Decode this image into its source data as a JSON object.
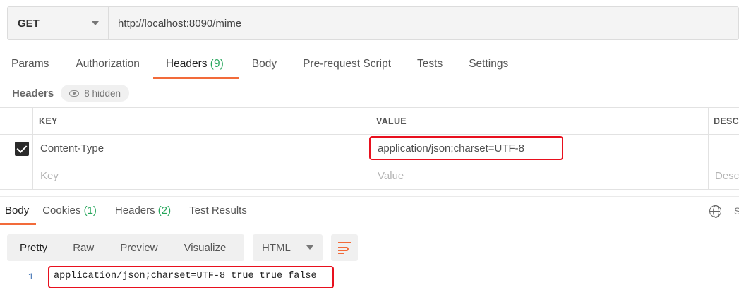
{
  "request": {
    "method": "GET",
    "url": "http://localhost:8090/mime"
  },
  "request_tabs": {
    "params": "Params",
    "authorization": "Authorization",
    "headers": "Headers",
    "headers_count": "(9)",
    "body": "Body",
    "pre_request": "Pre-request Script",
    "tests": "Tests",
    "settings": "Settings"
  },
  "headers_section": {
    "title": "Headers",
    "hidden_label": "8 hidden"
  },
  "headers_table": {
    "columns": [
      "KEY",
      "VALUE",
      "DESCR"
    ],
    "rows": [
      {
        "checked": true,
        "key": "Content-Type",
        "value": "application/json;charset=UTF-8"
      }
    ],
    "placeholders": {
      "key": "Key",
      "value": "Value",
      "description": "Desc"
    }
  },
  "response_tabs": {
    "body": "Body",
    "cookies": "Cookies",
    "cookies_count": "(1)",
    "headers": "Headers",
    "headers_count": "(2)",
    "test_results": "Test Results",
    "cut_label": "S"
  },
  "response_toolbar": {
    "views": [
      "Pretty",
      "Raw",
      "Preview",
      "Visualize"
    ],
    "active_view": "Pretty",
    "format": "HTML"
  },
  "response_body": {
    "line_number": "1",
    "text": "application/json;charset=UTF-8 true true false"
  },
  "colors": {
    "accent": "#f26b3a",
    "count_green": "#26a65b",
    "highlight_red": "#e8101e"
  },
  "icons": [
    "chevron-down-icon",
    "eye-icon",
    "checkbox-checked-icon",
    "globe-icon",
    "wrap-lines-icon"
  ]
}
